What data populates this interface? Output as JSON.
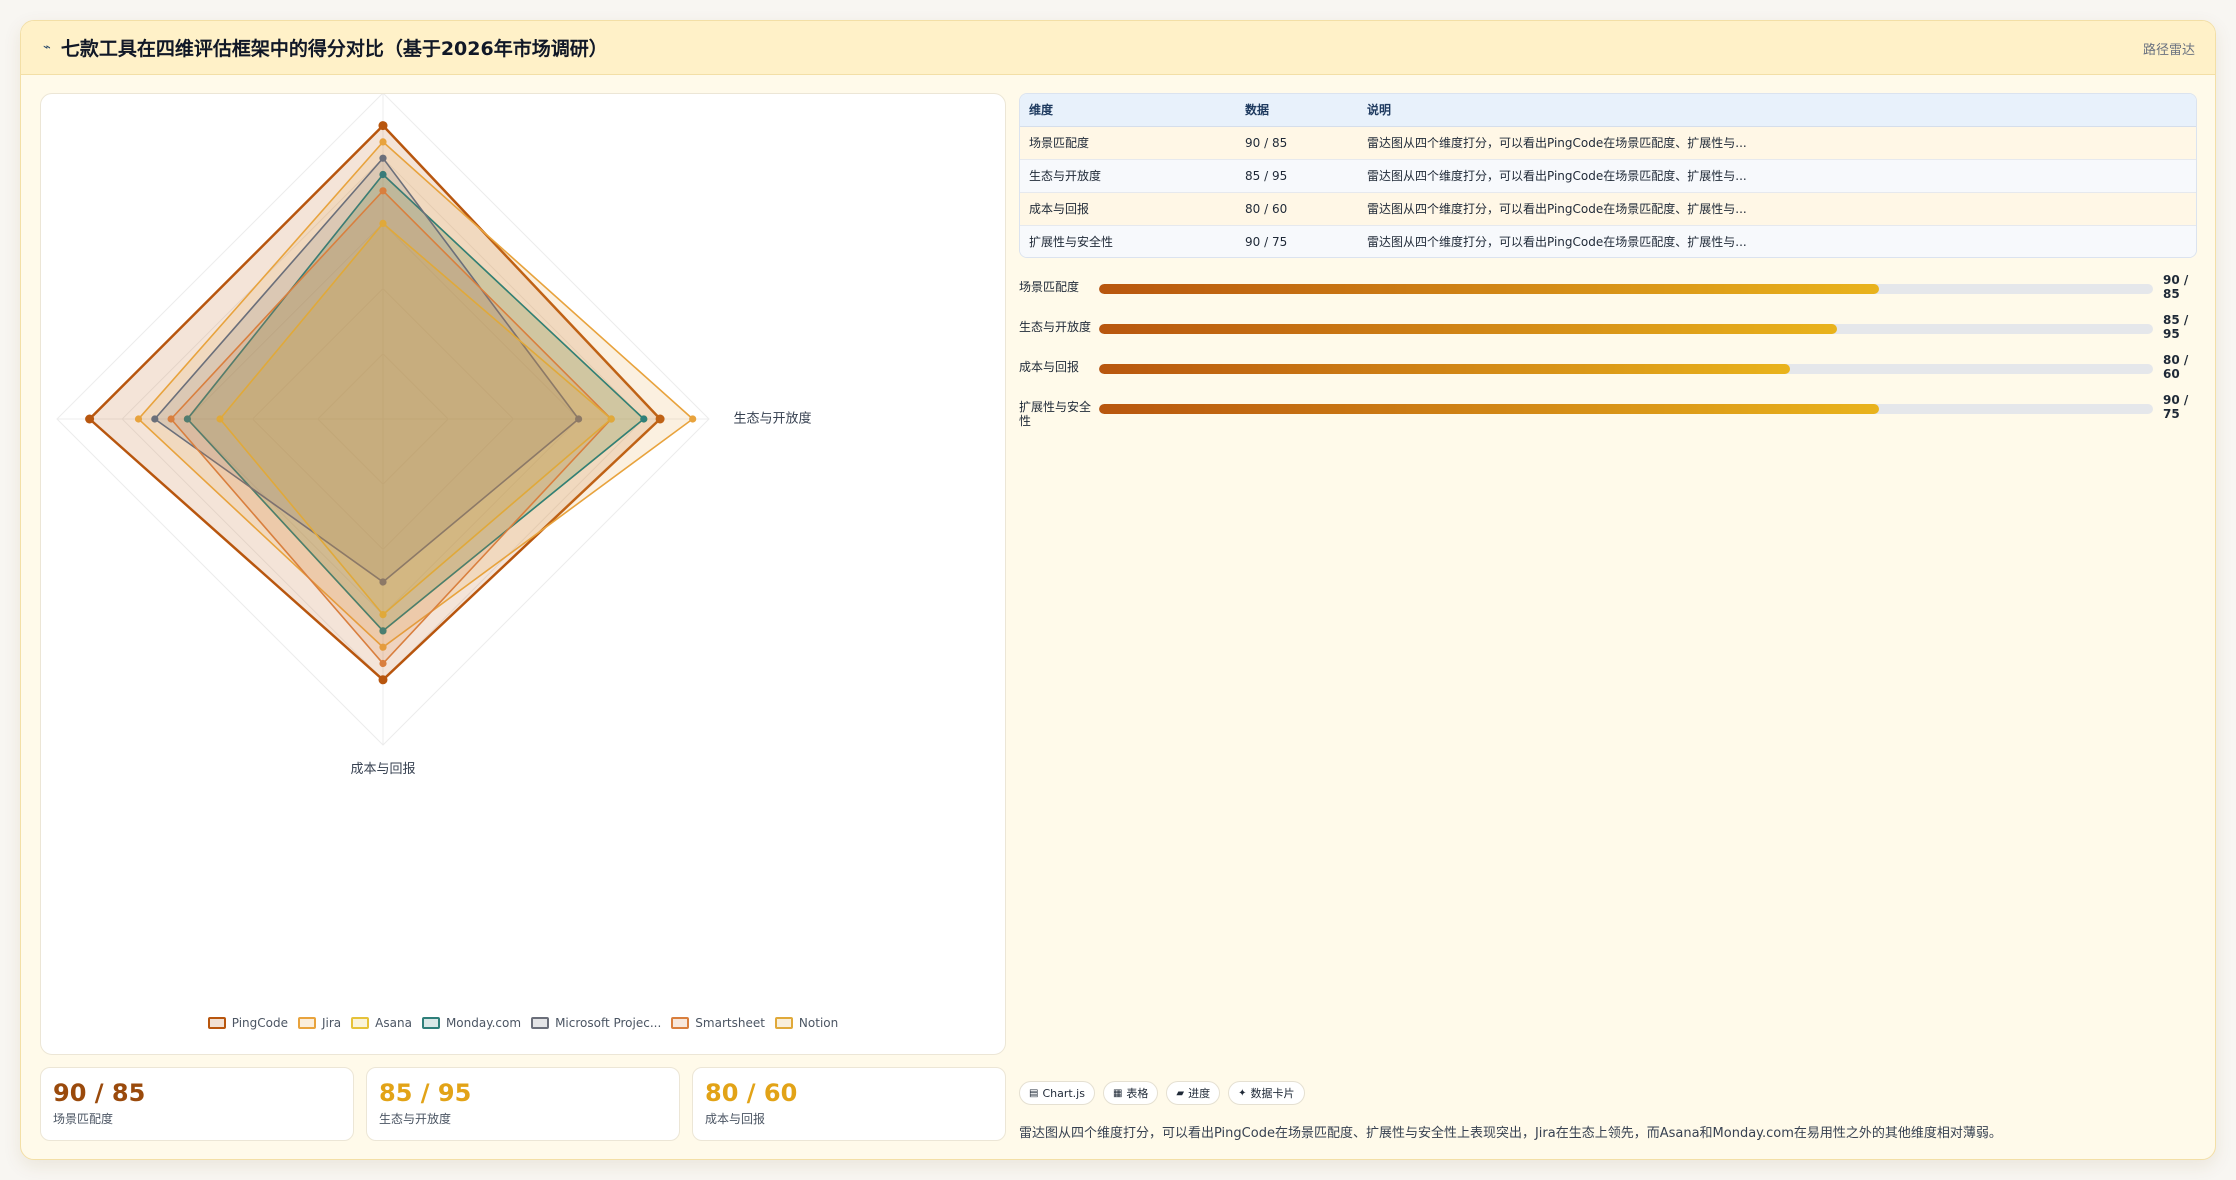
{
  "header": {
    "icon": "chart-line-icon",
    "title": "七款工具在四维评估框架中的得分对比（基于2026年市场调研）",
    "link": "路径雷达"
  },
  "chart_data": {
    "type": "radar",
    "axes": [
      "场景匹配度",
      "生态与开放度",
      "成本与回报",
      "扩展性与安全性"
    ],
    "r_range": [
      0,
      100
    ],
    "grid": true,
    "legend_position": "bottom",
    "series": [
      {
        "name": "PingCode",
        "values": [
          90,
          85,
          80,
          90
        ],
        "color": "#b8560e"
      },
      {
        "name": "Jira",
        "values": [
          85,
          95,
          70,
          75
        ],
        "color": "#e8a33d"
      },
      {
        "name": "Asana",
        "values": [
          75,
          80,
          65,
          60
        ],
        "color": "#e6c23a"
      },
      {
        "name": "Monday.com",
        "values": [
          75,
          80,
          65,
          60
        ],
        "color": "#2f7f7a"
      },
      {
        "name": "Microsoft Projec...",
        "values": [
          80,
          60,
          50,
          70
        ],
        "color": "#6b6f7a"
      },
      {
        "name": "Smartsheet",
        "values": [
          70,
          70,
          75,
          65
        ],
        "color": "#d97f3e"
      },
      {
        "name": "Notion",
        "values": [
          60,
          70,
          60,
          50
        ],
        "color": "#e0a93a"
      }
    ]
  },
  "table": {
    "headers": [
      "维度",
      "数据",
      "说明"
    ],
    "rows": [
      {
        "dimension": "场景匹配度",
        "value": "90 / 85",
        "note": "雷达图从四个维度打分，可以看出PingCode在场景匹配度、扩展性与..."
      },
      {
        "dimension": "生态与开放度",
        "value": "85 / 95",
        "note": "雷达图从四个维度打分，可以看出PingCode在场景匹配度、扩展性与..."
      },
      {
        "dimension": "成本与回报",
        "value": "80 / 60",
        "note": "雷达图从四个维度打分，可以看出PingCode在场景匹配度、扩展性与..."
      },
      {
        "dimension": "扩展性与安全性",
        "value": "90 / 75",
        "note": "雷达图从四个维度打分，可以看出PingCode在场景匹配度、扩展性与..."
      }
    ]
  },
  "progress": [
    {
      "label": "场景匹配度",
      "value_line1": "90 /",
      "value_line2": "85",
      "fraction": 0.74
    },
    {
      "label": "生态与开放度",
      "value_line1": "85 /",
      "value_line2": "95",
      "fraction": 0.7
    },
    {
      "label": "成本与回报",
      "value_line1": "80 /",
      "value_line2": "60",
      "fraction": 0.656
    },
    {
      "label": "扩展性与安全性",
      "value_line1": "90 /",
      "value_line2": "75",
      "fraction": 0.74
    }
  ],
  "kpis": [
    {
      "value": "90 / 85",
      "label": "场景匹配度",
      "color": "#9a4a0c"
    },
    {
      "value": "85 / 95",
      "label": "生态与开放度",
      "color": "#e2a317"
    },
    {
      "value": "80 / 60",
      "label": "成本与回报",
      "color": "#e2a317"
    }
  ],
  "chips": [
    {
      "icon": "chart-icon",
      "glyph": "▤",
      "label": "Chart.js"
    },
    {
      "icon": "table-icon",
      "glyph": "▦",
      "label": "表格"
    },
    {
      "icon": "progress-icon",
      "glyph": "▰",
      "label": "进度"
    },
    {
      "icon": "card-icon",
      "glyph": "✦",
      "label": "数据卡片"
    }
  ],
  "summary": "雷达图从四个维度打分，可以看出PingCode在场景匹配度、扩展性与安全性上表现突出，Jira在生态上领先，而Asana和Monday.com在易用性之外的其他维度相对薄弱。"
}
